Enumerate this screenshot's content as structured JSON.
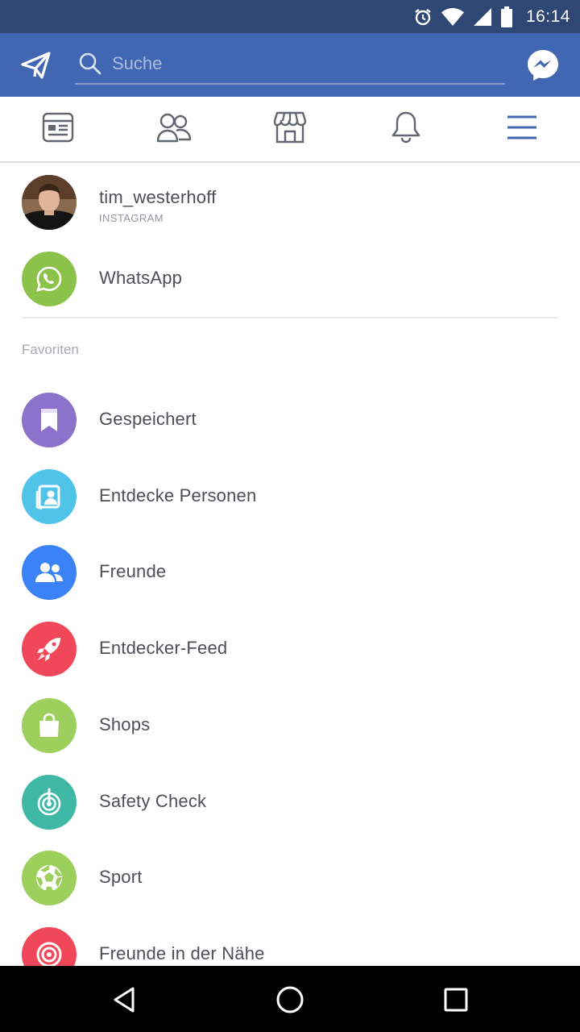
{
  "status_bar": {
    "time": "16:14",
    "icons": [
      "alarm-icon",
      "wifi-icon",
      "cell-signal-icon",
      "battery-icon"
    ]
  },
  "header": {
    "search_placeholder": "Suche",
    "left_icon": "send-icon",
    "right_icon": "messenger-icon",
    "background": "#4267b2"
  },
  "tabs": [
    {
      "name": "news-feed",
      "icon": "news-feed-icon"
    },
    {
      "name": "friends",
      "icon": "friends-icon"
    },
    {
      "name": "marketplace",
      "icon": "marketplace-icon"
    },
    {
      "name": "notifications",
      "icon": "bell-icon"
    },
    {
      "name": "menu",
      "icon": "hamburger-menu-icon",
      "active": true
    }
  ],
  "accounts": [
    {
      "label": "tim_westerhoff",
      "sublabel": "INSTAGRAM",
      "icon": "profile-photo"
    },
    {
      "label": "WhatsApp",
      "icon": "whatsapp-icon",
      "color": "#8bc34a"
    }
  ],
  "favorites": {
    "title": "Favoriten",
    "items": [
      {
        "label": "Gespeichert",
        "icon": "bookmark-icon",
        "color": "#8c72cb"
      },
      {
        "label": "Entdecke Personen",
        "icon": "person-card-icon",
        "color": "#4fc3e8"
      },
      {
        "label": "Freunde",
        "icon": "friends-icon",
        "color": "#3b82f6"
      },
      {
        "label": "Entdecker-Feed",
        "icon": "rocket-icon",
        "color": "#f04858"
      },
      {
        "label": "Shops",
        "icon": "shopping-bag-icon",
        "color": "#9ccf5c"
      },
      {
        "label": "Safety Check",
        "icon": "safety-check-icon",
        "color": "#3fb8a5"
      },
      {
        "label": "Sport",
        "icon": "soccer-ball-icon",
        "color": "#9ccf5c"
      },
      {
        "label": "Freunde in der Nähe",
        "icon": "target-icon",
        "color": "#f04858"
      }
    ]
  },
  "nav_bar": [
    "back-icon",
    "home-icon",
    "recents-icon"
  ]
}
